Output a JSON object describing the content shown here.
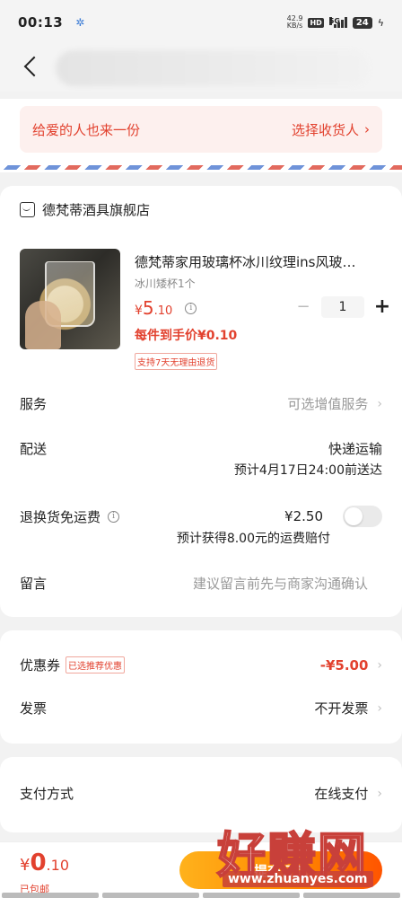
{
  "status_bar": {
    "time": "00:13",
    "network_speed_value": "42.9",
    "network_speed_unit": "KB/s",
    "hd_badge": "HD",
    "signal_label": "5G",
    "battery": "24"
  },
  "address_banner": {
    "prompt": "给爱的人也来一份",
    "action": "选择收货人"
  },
  "shop": {
    "name": "德梵蒂酒具旗舰店",
    "product": {
      "title": "德梵蒂家用玻璃杯冰川纹理ins风玻…",
      "spec": "冰川矮杯1个",
      "price_symbol": "¥",
      "price_int": "5",
      "price_dec": ".10",
      "quantity": "1",
      "final_price_note": "每件到手价¥0.10",
      "return_badge": "支持7天无理由退货"
    },
    "rows": {
      "service_label": "服务",
      "service_value": "可选增值服务",
      "delivery_label": "配送",
      "delivery_value": "快递运输",
      "delivery_eta": "预计4月17日24:00前送达",
      "return_ship_label": "退换货免运费",
      "return_ship_price": "¥2.50",
      "return_ship_note": "预计获得8.00元的运费赔付",
      "message_label": "留言",
      "message_placeholder": "建议留言前先与商家沟通确认"
    }
  },
  "coupon": {
    "label": "优惠券",
    "tag": "已选推荐优惠",
    "value": "-¥5.00",
    "invoice_label": "发票",
    "invoice_value": "不开发票"
  },
  "payment": {
    "label": "支付方式",
    "value": "在线支付"
  },
  "bottom": {
    "total_symbol": "¥",
    "total_int": "0",
    "total_dec": ".10",
    "shipping_note": "已包邮",
    "submit_label": "提交订单"
  },
  "watermark": {
    "text": "好赚网",
    "url": "www.zhuanyes.com"
  },
  "colors": {
    "accent_red": "#e2412e",
    "button_gradient_start": "#ffb21c",
    "button_gradient_end": "#ff5400"
  }
}
